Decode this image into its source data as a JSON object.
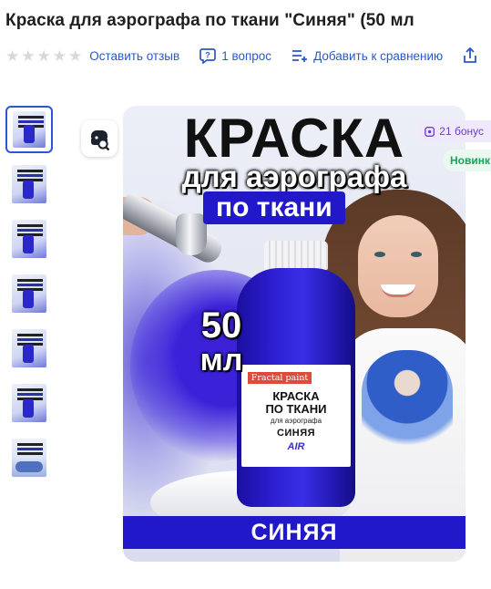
{
  "product": {
    "title": "Краска для аэрографа по ткани \"Синяя\" (50 мл"
  },
  "rating": {
    "stars_filled": 0,
    "stars_total": 5
  },
  "meta_links": {
    "review": "Оставить отзыв",
    "questions": "1 вопрос",
    "compare": "Добавить к сравнению"
  },
  "badges": {
    "bonus": "21 бонус",
    "new": "Новинк"
  },
  "gallery": {
    "thumbnail_count": 7,
    "active_index": 0
  },
  "hero_image": {
    "headline": "КРАСКА",
    "subheadline": "для аэрографа",
    "tag": "по ткани",
    "volume_number": "50",
    "volume_unit": "мл",
    "footer": "СИНЯЯ",
    "label_brand": "Fractal paint",
    "label_name_line1": "КРАСКА",
    "label_name_line2": "ПО ТКАНИ",
    "label_sub": "для аэрографа",
    "label_color": "СИНЯЯ",
    "label_air": "AIR"
  },
  "colors": {
    "link": "#2a57c9",
    "accent_blue": "#2119c9",
    "bonus_text": "#6a3fd1",
    "new_text": "#19a45a",
    "star_empty": "#d6d8dc"
  }
}
